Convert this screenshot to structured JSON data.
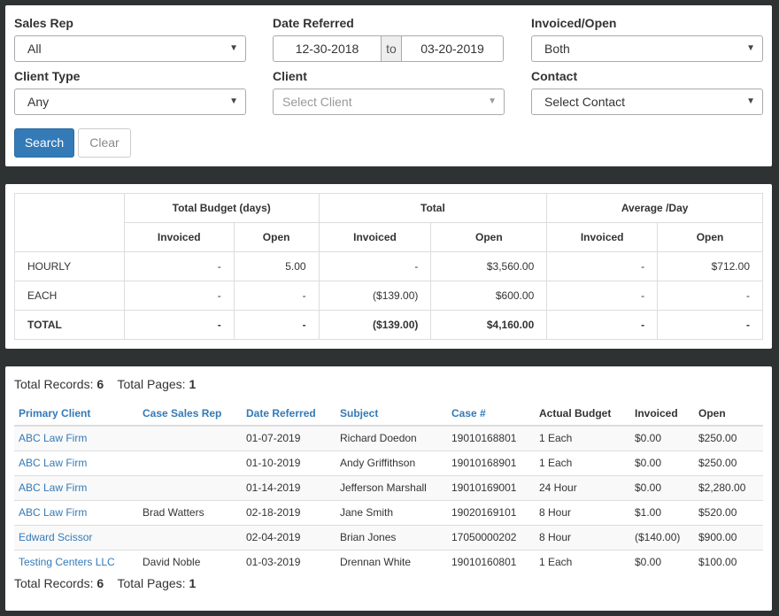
{
  "filters": {
    "sales_rep": {
      "label": "Sales Rep",
      "value": "All"
    },
    "date_referred": {
      "label": "Date Referred",
      "from": "12-30-2018",
      "to_text": "to",
      "to": "03-20-2019"
    },
    "invoiced_open": {
      "label": "Invoiced/Open",
      "value": "Both"
    },
    "client_type": {
      "label": "Client Type",
      "value": "Any"
    },
    "client": {
      "label": "Client",
      "placeholder": "Select Client"
    },
    "contact": {
      "label": "Contact",
      "value": "Select Contact"
    },
    "search_label": "Search",
    "clear_label": "Clear"
  },
  "summary": {
    "groups": [
      "Total Budget (days)",
      "Total",
      "Average /Day"
    ],
    "subheaders": [
      "Invoiced",
      "Open",
      "Invoiced",
      "Open",
      "Invoiced",
      "Open"
    ],
    "rows": [
      {
        "label": "HOURLY",
        "cells": [
          "-",
          "5.00",
          "-",
          "$3,560.00",
          "-",
          "$712.00"
        ]
      },
      {
        "label": "EACH",
        "cells": [
          "-",
          "-",
          "($139.00)",
          "$600.00",
          "-",
          "-"
        ]
      },
      {
        "label": "TOTAL",
        "cells": [
          "-",
          "-",
          "($139.00)",
          "$4,160.00",
          "-",
          "-"
        ]
      }
    ]
  },
  "records": {
    "total_records_label": "Total Records:",
    "total_records": "6",
    "total_pages_label": "Total Pages:",
    "total_pages": "1",
    "columns": [
      "Primary Client",
      "Case Sales Rep",
      "Date Referred",
      "Subject",
      "Case #",
      "Actual Budget",
      "Invoiced",
      "Open"
    ],
    "rows": [
      [
        "ABC Law Firm",
        "",
        "01-07-2019",
        "Richard Doedon",
        "19010168801",
        "1 Each",
        "$0.00",
        "$250.00"
      ],
      [
        "ABC Law Firm",
        "",
        "01-10-2019",
        "Andy Griffithson",
        "19010168901",
        "1 Each",
        "$0.00",
        "$250.00"
      ],
      [
        "ABC Law Firm",
        "",
        "01-14-2019",
        "Jefferson Marshall",
        "19010169001",
        "24 Hour",
        "$0.00",
        "$2,280.00"
      ],
      [
        "ABC Law Firm",
        "Brad Watters",
        "02-18-2019",
        "Jane Smith",
        "19020169101",
        "8 Hour",
        "$1.00",
        "$520.00"
      ],
      [
        "Edward Scissor",
        "",
        "02-04-2019",
        "Brian Jones",
        "17050000202",
        "8 Hour",
        "($140.00)",
        "$900.00"
      ],
      [
        "Testing Centers LLC",
        "David Noble",
        "01-03-2019",
        "Drennan White",
        "19010160801",
        "1 Each",
        "$0.00",
        "$100.00"
      ]
    ]
  }
}
